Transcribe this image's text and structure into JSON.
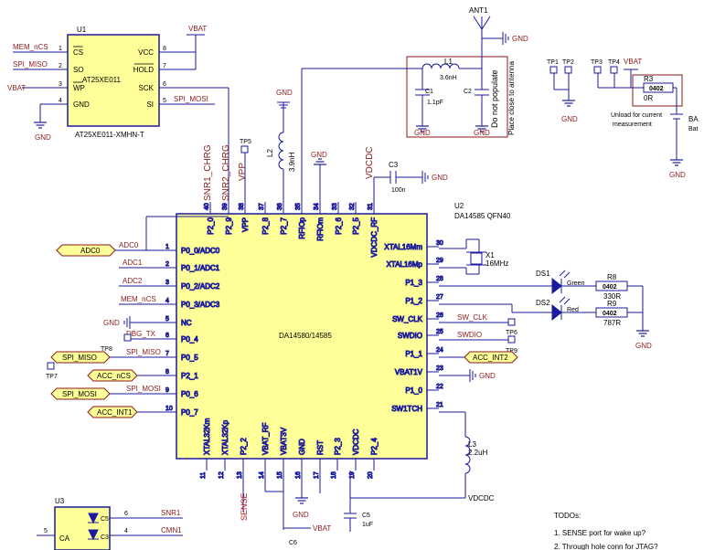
{
  "colors": {
    "wire": "#1a1a9c",
    "net": "#8b1a1a",
    "ic_fill": "#ffff99",
    "port_fill": "#ffff99",
    "text": "#000000",
    "hilite": "#b51a1a"
  },
  "u1": {
    "designator": "U1",
    "part": "AT25XE011",
    "footprint": "AT25XE011-XMHN-T",
    "pins": [
      {
        "num": "1",
        "name": "CS",
        "net": "MEM_nCS"
      },
      {
        "num": "2",
        "name": "SO",
        "net": "SPI_MISO"
      },
      {
        "num": "3",
        "name": "WP",
        "net": "VBAT"
      },
      {
        "num": "4",
        "name": "GND",
        "net": "GND"
      },
      {
        "num": "8",
        "name": "VCC",
        "net": "VBAT"
      },
      {
        "num": "7",
        "name": "HOLD",
        "net": ""
      },
      {
        "num": "6",
        "name": "SCK",
        "net": ""
      },
      {
        "num": "5",
        "name": "SI",
        "net": "SPI_MOSI"
      }
    ]
  },
  "u2": {
    "designator": "U2",
    "part": "DA14585 QFN40",
    "center_label": "DA14580/14585",
    "top_pins": [
      {
        "num": "40",
        "name": "P2_0",
        "net": "SNR1_CHRG"
      },
      {
        "num": "39",
        "name": "P2_9",
        "net": "SNR2_CHRG"
      },
      {
        "num": "38",
        "name": "VPP",
        "net": "VPP"
      },
      {
        "num": "37",
        "name": "P2_8",
        "net": ""
      },
      {
        "num": "36",
        "name": "P2_7",
        "net": ""
      },
      {
        "num": "35",
        "name": "RFIOp",
        "net": ""
      },
      {
        "num": "34",
        "name": "RFIOm",
        "net": ""
      },
      {
        "num": "33",
        "name": "P2_6",
        "net": ""
      },
      {
        "num": "32",
        "name": "P2_5",
        "net": ""
      },
      {
        "num": "31",
        "name": "VDCDC_RF",
        "net": "VDCDC"
      }
    ],
    "left_pins": [
      {
        "num": "1",
        "name": "P0_0/ADC0",
        "net": "ADC0"
      },
      {
        "num": "2",
        "name": "P0_1/ADC1",
        "net": "ADC1"
      },
      {
        "num": "3",
        "name": "P0_2/ADC2",
        "net": "ADC2"
      },
      {
        "num": "4",
        "name": "P0_3/ADC3",
        "net": "MEM_nCS"
      },
      {
        "num": "5",
        "name": "NC",
        "net": "GND"
      },
      {
        "num": "6",
        "name": "P0_4",
        "net": "DBG_TX"
      },
      {
        "num": "7",
        "name": "P0_5",
        "net": "SPI_MISO"
      },
      {
        "num": "8",
        "name": "P2_1",
        "net": ""
      },
      {
        "num": "9",
        "name": "P0_6",
        "net": "SPI_MOSI"
      },
      {
        "num": "10",
        "name": "P0_7",
        "net": ""
      }
    ],
    "right_pins": [
      {
        "num": "30",
        "name": "XTAL16Mm",
        "net": ""
      },
      {
        "num": "29",
        "name": "XTAL16Mp",
        "net": ""
      },
      {
        "num": "28",
        "name": "P1_3",
        "net": ""
      },
      {
        "num": "27",
        "name": "P1_2",
        "net": ""
      },
      {
        "num": "26",
        "name": "SW_CLK",
        "net": "SW_CLK"
      },
      {
        "num": "25",
        "name": "SWDIO",
        "net": "SWDIO"
      },
      {
        "num": "24",
        "name": "P1_1",
        "net": ""
      },
      {
        "num": "23",
        "name": "VBAT1V",
        "net": ""
      },
      {
        "num": "22",
        "name": "P1_0",
        "net": ""
      },
      {
        "num": "21",
        "name": "SW1TCH",
        "net": ""
      }
    ],
    "bottom_pins": [
      {
        "num": "11",
        "name": "XTAL32Km",
        "net": ""
      },
      {
        "num": "12",
        "name": "XTAL32Kp",
        "net": ""
      },
      {
        "num": "13",
        "name": "P2_2",
        "net": "SENSE"
      },
      {
        "num": "14",
        "name": "VBAT_RF",
        "net": ""
      },
      {
        "num": "15",
        "name": "VBAT3V",
        "net": ""
      },
      {
        "num": "16",
        "name": "GND",
        "net": ""
      },
      {
        "num": "17",
        "name": "RST",
        "net": ""
      },
      {
        "num": "18",
        "name": "P2_3",
        "net": ""
      },
      {
        "num": "19",
        "name": "VDCDC",
        "net": ""
      },
      {
        "num": "20",
        "name": "P2_4",
        "net": ""
      }
    ]
  },
  "ports": {
    "adc0": "ADC0",
    "spi_miso": "SPI_MISO",
    "acc_ncs": "ACC_nCS",
    "spi_mosi": "SPI_MOSI",
    "acc_int1": "ACC_INT1",
    "acc_int2": "ACC_INT2"
  },
  "nets": {
    "gnd": "GND",
    "vbat": "VBAT",
    "vdcdc": "VDCDC",
    "sense": "SENSE",
    "snr1": "SNR1",
    "cmn1": "CMN1"
  },
  "antenna": {
    "ant": "ANT1",
    "l1": "L1",
    "l1_val": "3.6nH",
    "c1": "C1",
    "c1_val": "1.1pF",
    "c2": "C2",
    "dnp": "Do not populate",
    "note": "Place close to antenna"
  },
  "l2": {
    "ref": "L2",
    "val": "3.9nH"
  },
  "c3": {
    "ref": "C3",
    "val": "100n"
  },
  "l3": {
    "ref": "L3",
    "val": "2.2uH"
  },
  "c5": {
    "ref": "C5",
    "val": "1uF"
  },
  "c6": {
    "ref": "C6"
  },
  "x1": {
    "ref": "X1",
    "val": "16MHz"
  },
  "leds": [
    {
      "ref": "DS1",
      "color": "Green",
      "r": "R8",
      "pkg": "0402",
      "val": "330R"
    },
    {
      "ref": "DS2",
      "color": "Red",
      "r": "R9",
      "pkg": "0402",
      "val": "787R"
    }
  ],
  "testpoints": [
    "TP1",
    "TP2",
    "TP3",
    "TP4",
    "TP5",
    "TP6",
    "TP7",
    "TP8",
    "TP9"
  ],
  "r3": {
    "ref": "R3",
    "pkg": "0402",
    "val": "0R",
    "note1": "Unload for current",
    "note2": "measurement"
  },
  "bat": {
    "ref": "BA",
    "val": "Bat"
  },
  "u3": {
    "ref": "U3",
    "pin_ca": "CA",
    "c5": "C5",
    "c3": "C3",
    "p6": "6",
    "p4": "4",
    "p5": "5"
  },
  "todo": {
    "title": "TODOs:",
    "item1": "1. SENSE port for wake up?",
    "item2": "2. Through hole conn for JTAG?"
  }
}
